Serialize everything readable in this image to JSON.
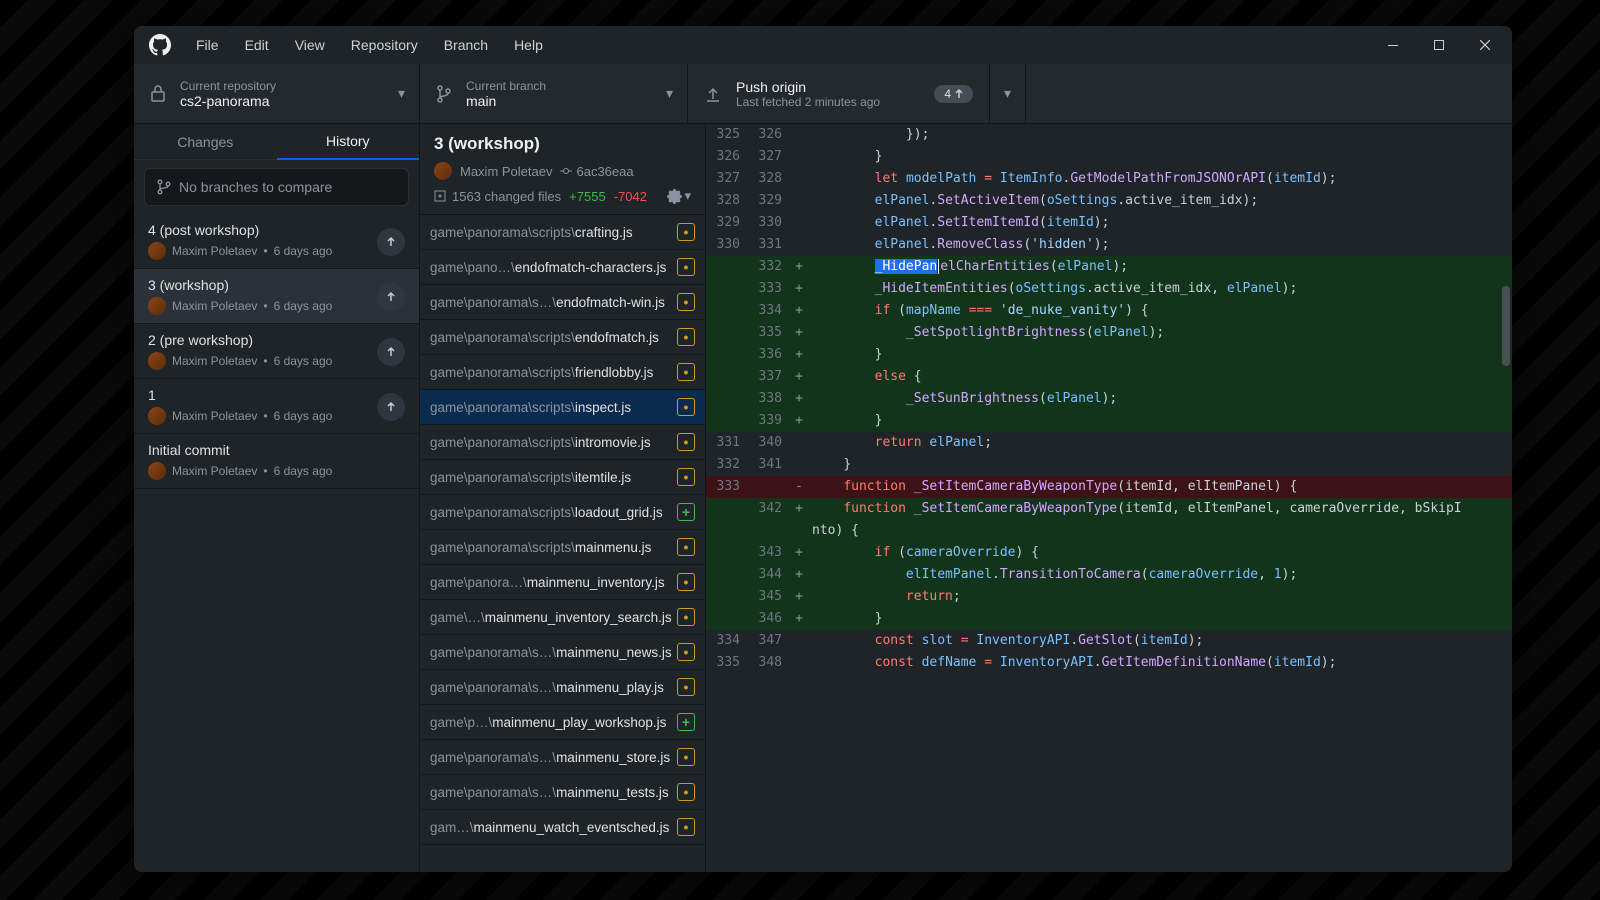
{
  "menu": {
    "file": "File",
    "edit": "Edit",
    "view": "View",
    "repository": "Repository",
    "branch": "Branch",
    "help": "Help"
  },
  "toolbar": {
    "repo_label": "Current repository",
    "repo_value": "cs2-panorama",
    "branch_label": "Current branch",
    "branch_value": "main",
    "push_label": "Push origin",
    "push_sub": "Last fetched 2 minutes ago",
    "push_count": "4"
  },
  "tabs": {
    "changes": "Changes",
    "history": "History"
  },
  "compare": "No branches to compare",
  "commits": [
    {
      "title": "4 (post workshop)",
      "author": "Maxim Poletaev",
      "when": "6 days ago",
      "push": true
    },
    {
      "title": "3 (workshop)",
      "author": "Maxim Poletaev",
      "when": "6 days ago",
      "push": true,
      "selected": true
    },
    {
      "title": "2 (pre workshop)",
      "author": "Maxim Poletaev",
      "when": "6 days ago",
      "push": true
    },
    {
      "title": "1",
      "author": "Maxim Poletaev",
      "when": "6 days ago",
      "push": true
    },
    {
      "title": "Initial commit",
      "author": "Maxim Poletaev",
      "when": "6 days ago",
      "push": false
    }
  ],
  "header": {
    "title": "3 (workshop)",
    "author": "Maxim Poletaev",
    "sha": "6ac36eaa",
    "files": "1563 changed files",
    "add": "+7555",
    "del": "-7042"
  },
  "files": [
    {
      "pre": "game\\panorama\\scripts\\",
      "name": "crafting.js",
      "t": "m"
    },
    {
      "pre": "game\\pano…\\",
      "name": "endofmatch-characters.js",
      "t": "m"
    },
    {
      "pre": "game\\panorama\\s…\\",
      "name": "endofmatch-win.js",
      "t": "m"
    },
    {
      "pre": "game\\panorama\\scripts\\",
      "name": "endofmatch.js",
      "t": "m"
    },
    {
      "pre": "game\\panorama\\scripts\\",
      "name": "friendlobby.js",
      "t": "m"
    },
    {
      "pre": "game\\panorama\\scripts\\",
      "name": "inspect.js",
      "t": "m",
      "selected": true
    },
    {
      "pre": "game\\panorama\\scripts\\",
      "name": "intromovie.js",
      "t": "m"
    },
    {
      "pre": "game\\panorama\\scripts\\",
      "name": "itemtile.js",
      "t": "m"
    },
    {
      "pre": "game\\panorama\\scripts\\",
      "name": "loadout_grid.js",
      "t": "a"
    },
    {
      "pre": "game\\panorama\\scripts\\",
      "name": "mainmenu.js",
      "t": "m"
    },
    {
      "pre": "game\\panora…\\",
      "name": "mainmenu_inventory.js",
      "t": "m"
    },
    {
      "pre": "game\\…\\",
      "name": "mainmenu_inventory_search.js",
      "t": "m"
    },
    {
      "pre": "game\\panorama\\s…\\",
      "name": "mainmenu_news.js",
      "t": "m"
    },
    {
      "pre": "game\\panorama\\s…\\",
      "name": "mainmenu_play.js",
      "t": "m"
    },
    {
      "pre": "game\\p…\\",
      "name": "mainmenu_play_workshop.js",
      "t": "a"
    },
    {
      "pre": "game\\panorama\\s…\\",
      "name": "mainmenu_store.js",
      "t": "m"
    },
    {
      "pre": "game\\panorama\\s…\\",
      "name": "mainmenu_tests.js",
      "t": "m"
    },
    {
      "pre": "gam…\\",
      "name": "mainmenu_watch_eventsched.js",
      "t": "m"
    }
  ],
  "diff": [
    {
      "o": "325",
      "n": "326",
      "m": "",
      "html": "            <span class='plain'>});</span>"
    },
    {
      "o": "326",
      "n": "327",
      "m": "",
      "html": "        <span class='plain'>}</span>"
    },
    {
      "o": "327",
      "n": "328",
      "m": "",
      "html": "        <span class='kw'>let</span> <span class='var'>modelPath</span> <span class='op'>=</span> <span class='var'>ItemInfo</span><span class='plain'>.</span><span class='fn'>GetModelPathFromJSONOrAPI</span><span class='plain'>(</span><span class='var'>itemId</span><span class='plain'>);</span>"
    },
    {
      "o": "328",
      "n": "329",
      "m": "",
      "html": "        <span class='var'>elPanel</span><span class='plain'>.</span><span class='fn'>SetActiveItem</span><span class='plain'>(</span><span class='var'>oSettings</span><span class='plain'>.active_item_idx);</span>"
    },
    {
      "o": "329",
      "n": "330",
      "m": "",
      "html": "        <span class='var'>elPanel</span><span class='plain'>.</span><span class='fn'>SetItemItemId</span><span class='plain'>(</span><span class='var'>itemId</span><span class='plain'>);</span>"
    },
    {
      "o": "330",
      "n": "331",
      "m": "",
      "html": "        <span class='var'>elPanel</span><span class='plain'>.</span><span class='fn'>RemoveClass</span><span class='plain'>(</span><span class='str'>'hidden'</span><span class='plain'>);</span>"
    },
    {
      "o": "",
      "n": "332",
      "m": "+",
      "t": "add",
      "html": "        <span class='sel-hilite'>_HidePan</span><span class='text-cursor'></span><span class='fn'>elCharEntities</span><span class='plain'>(</span><span class='var'>elPanel</span><span class='plain'>);</span>"
    },
    {
      "o": "",
      "n": "333",
      "m": "+",
      "t": "add",
      "html": "        <span class='fn'>_HideItemEntities</span><span class='plain'>(</span><span class='var'>oSettings</span><span class='plain'>.active_item_idx, </span><span class='var'>elPanel</span><span class='plain'>);</span>"
    },
    {
      "o": "",
      "n": "334",
      "m": "+",
      "t": "add",
      "html": "        <span class='kw'>if</span> <span class='plain'>(</span><span class='var'>mapName</span> <span class='op'>===</span> <span class='str'>'de_nuke_vanity'</span><span class='plain'>) {</span>"
    },
    {
      "o": "",
      "n": "335",
      "m": "+",
      "t": "add",
      "html": "            <span class='fn'>_SetSpotlightBrightness</span><span class='plain'>(</span><span class='var'>elPanel</span><span class='plain'>);</span>"
    },
    {
      "o": "",
      "n": "336",
      "m": "+",
      "t": "add",
      "html": "        <span class='plain'>}</span>"
    },
    {
      "o": "",
      "n": "337",
      "m": "+",
      "t": "add",
      "html": "        <span class='kw'>else</span> <span class='plain'>{</span>"
    },
    {
      "o": "",
      "n": "338",
      "m": "+",
      "t": "add",
      "html": "            <span class='fn'>_SetSunBrightness</span><span class='plain'>(</span><span class='var'>elPanel</span><span class='plain'>);</span>"
    },
    {
      "o": "",
      "n": "339",
      "m": "+",
      "t": "add",
      "html": "        <span class='plain'>}</span>"
    },
    {
      "o": "331",
      "n": "340",
      "m": "",
      "html": "        <span class='kw'>return</span> <span class='var'>elPanel</span><span class='plain'>;</span>"
    },
    {
      "o": "332",
      "n": "341",
      "m": "",
      "html": "    <span class='plain'>}</span>"
    },
    {
      "o": "333",
      "n": "",
      "m": "-",
      "t": "del",
      "html": "    <span class='kw'>function</span> <span class='fn'>_SetItemCameraByWeaponType</span><span class='plain'>(itemId, elItemPanel) {</span>"
    },
    {
      "o": "",
      "n": "342",
      "m": "+",
      "t": "add",
      "html": "    <span class='kw'>function</span> <span class='fn'>_SetItemCameraByWeaponType</span><span class='plain'>(itemId, elItemPanel, cameraOverride, bSkipI</span>"
    },
    {
      "o": "",
      "n": "",
      "m": "",
      "t": "add",
      "html": "<span class='plain'>nto) {</span>"
    },
    {
      "o": "",
      "n": "343",
      "m": "+",
      "t": "add",
      "html": "        <span class='kw'>if</span> <span class='plain'>(</span><span class='var'>cameraOverride</span><span class='plain'>) {</span>"
    },
    {
      "o": "",
      "n": "344",
      "m": "+",
      "t": "add",
      "html": "            <span class='var'>elItemPanel</span><span class='plain'>.</span><span class='fn'>TransitionToCamera</span><span class='plain'>(</span><span class='var'>cameraOverride</span><span class='plain'>, </span><span class='num'>1</span><span class='plain'>);</span>"
    },
    {
      "o": "",
      "n": "345",
      "m": "+",
      "t": "add",
      "html": "            <span class='kw'>return</span><span class='plain'>;</span>"
    },
    {
      "o": "",
      "n": "346",
      "m": "+",
      "t": "add",
      "html": "        <span class='plain'>}</span>"
    },
    {
      "o": "334",
      "n": "347",
      "m": "",
      "html": "        <span class='kw'>const</span> <span class='var'>slot</span> <span class='op'>=</span> <span class='var'>InventoryAPI</span><span class='plain'>.</span><span class='fn'>GetSlot</span><span class='plain'>(</span><span class='var'>itemId</span><span class='plain'>);</span>"
    },
    {
      "o": "335",
      "n": "348",
      "m": "",
      "html": "        <span class='kw'>const</span> <span class='var'>defName</span> <span class='op'>=</span> <span class='var'>InventoryAPI</span><span class='plain'>.</span><span class='fn'>GetItemDefinitionName</span><span class='plain'>(</span><span class='var'>itemId</span><span class='plain'>);</span>"
    }
  ]
}
